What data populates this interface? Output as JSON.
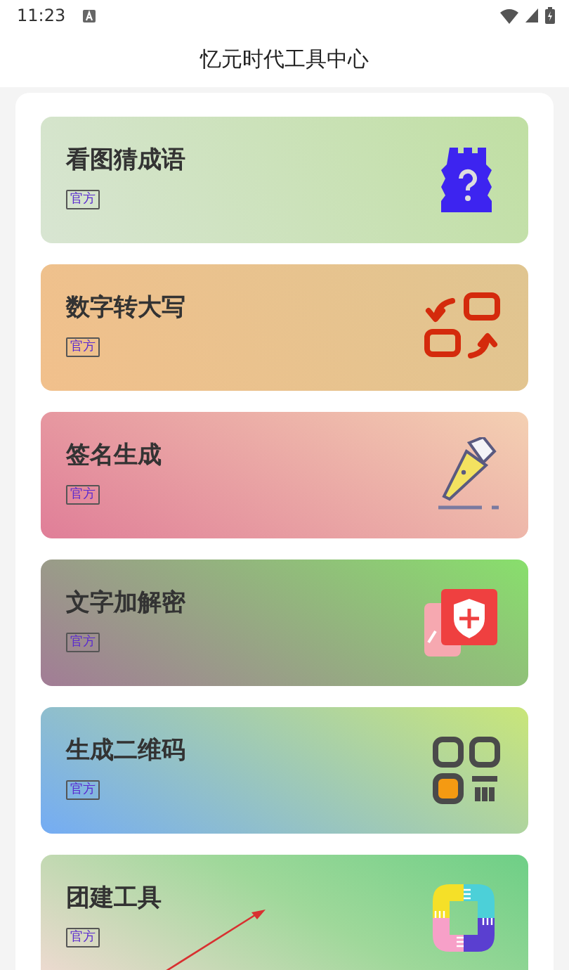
{
  "status_bar": {
    "time": "11:23"
  },
  "header": {
    "title": "忆元时代工具中心"
  },
  "tools": [
    {
      "kind": "idiom",
      "title": "看图猜成语",
      "tag": "官方"
    },
    {
      "kind": "convert",
      "title": "数字转大写",
      "tag": "官方"
    },
    {
      "kind": "signature",
      "title": "签名生成",
      "tag": "官方"
    },
    {
      "kind": "encrypt",
      "title": "文字加解密",
      "tag": "官方"
    },
    {
      "kind": "qrcode",
      "title": "生成二维码",
      "tag": "官方"
    },
    {
      "kind": "team",
      "title": "团建工具",
      "tag": "官方"
    }
  ]
}
